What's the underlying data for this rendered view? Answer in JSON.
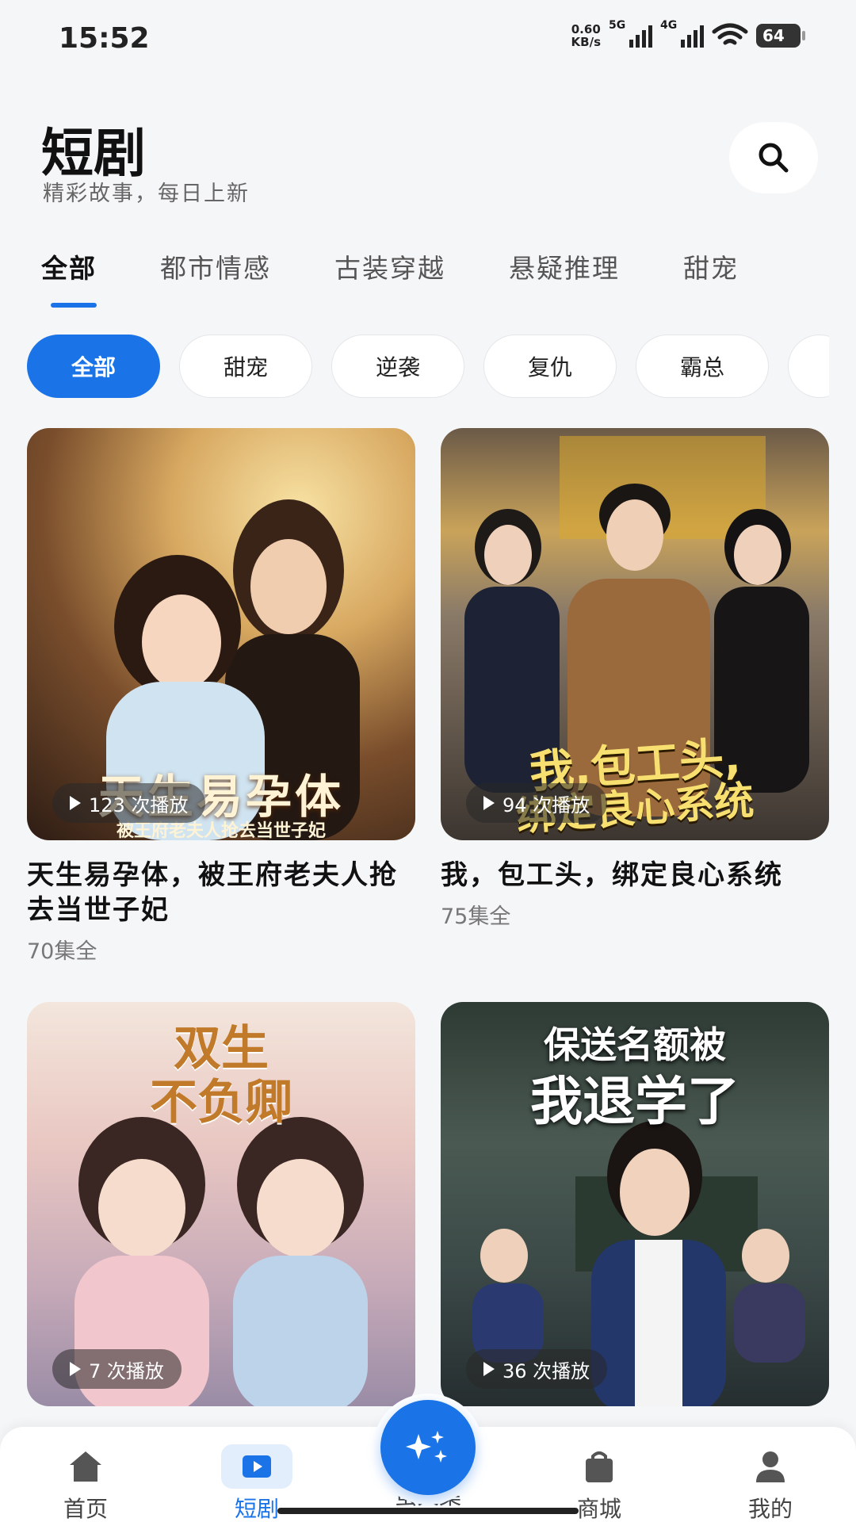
{
  "status_bar": {
    "time": "15:52",
    "net_speed_value": "0.60",
    "net_speed_unit": "KB/s",
    "signal1": "5G",
    "signal2": "4G",
    "battery": "64"
  },
  "header": {
    "title": "短剧",
    "subtitle": "精彩故事，每日上新",
    "search_icon": "search-icon"
  },
  "tabs": [
    {
      "label": "全部",
      "active": true
    },
    {
      "label": "都市情感",
      "active": false
    },
    {
      "label": "古装穿越",
      "active": false
    },
    {
      "label": "悬疑推理",
      "active": false
    },
    {
      "label": "甜宠",
      "active": false
    }
  ],
  "chips": [
    {
      "label": "全部",
      "active": true
    },
    {
      "label": "甜宠",
      "active": false
    },
    {
      "label": "逆袭",
      "active": false
    },
    {
      "label": "复仇",
      "active": false
    },
    {
      "label": "霸总",
      "active": false
    }
  ],
  "dramas": [
    {
      "title": "天生易孕体，被王府老夫人抢去当世子妃",
      "plays": "123 次播放",
      "episodes": "70集全",
      "poster_text": "天生易孕体",
      "poster_subtext": "被王府老夫人抢去当世子妃"
    },
    {
      "title": "我，包工头，绑定良心系统",
      "plays": "94 次播放",
      "episodes": "75集全",
      "poster_text": "我,包工头,",
      "poster_subtext": "绑定良心系统"
    },
    {
      "title": "",
      "plays": "7 次播放",
      "episodes": "",
      "poster_text": "双生",
      "poster_subtext": "不负卿"
    },
    {
      "title": "",
      "plays": "36 次播放",
      "episodes": "",
      "poster_text": "保送名额被",
      "poster_subtext": "我退学了"
    }
  ],
  "bottom_nav": [
    {
      "label": "首页",
      "icon": "home-icon",
      "active": false
    },
    {
      "label": "短剧",
      "icon": "play-icon",
      "active": true
    },
    {
      "label": "萤火集",
      "icon": "sparkle-icon",
      "active": false
    },
    {
      "label": "商城",
      "icon": "shopping-bag-icon",
      "active": false
    },
    {
      "label": "我的",
      "icon": "person-icon",
      "active": false
    }
  ],
  "colors": {
    "accent": "#1a74e8",
    "background": "#f5f6f8"
  }
}
